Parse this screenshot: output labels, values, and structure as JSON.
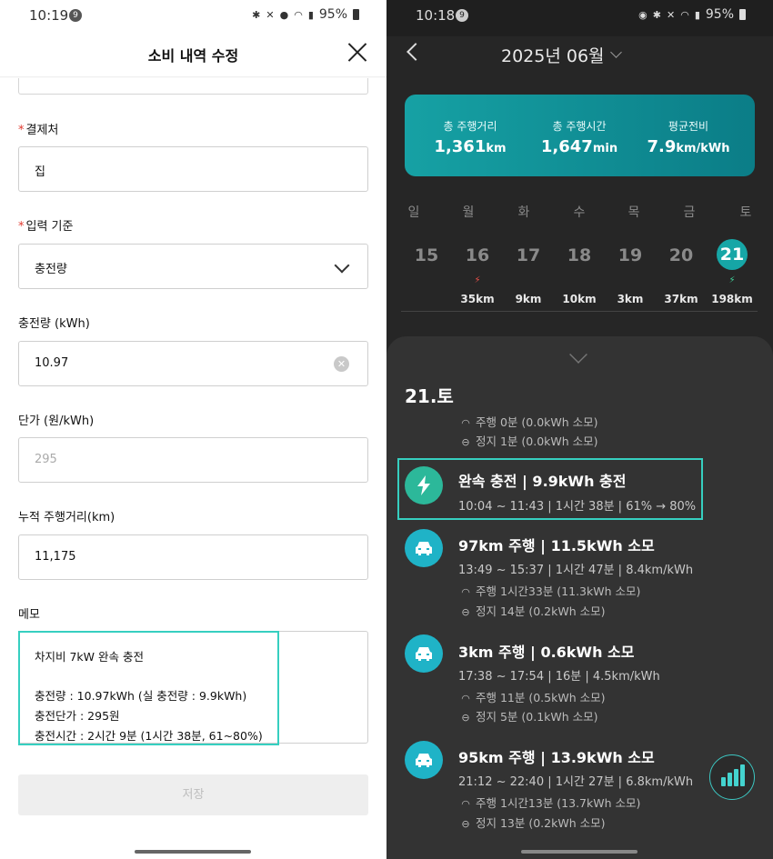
{
  "left_screen": {
    "status_bar": {
      "time": "10:19",
      "badge": "9",
      "battery": "95%"
    },
    "header": {
      "title": "소비 내역 수정"
    },
    "fields": {
      "merchant": {
        "label": "결제처",
        "required_mark": "*",
        "value": "집"
      },
      "input_basis": {
        "label": "입력 기준",
        "required_mark": "*",
        "value": "충전량"
      },
      "charge_amount": {
        "label": "충전량 (kWh)",
        "value": "10.97"
      },
      "unit_price": {
        "label": "단가 (원/kWh)",
        "placeholder": "295"
      },
      "odometer": {
        "label": "누적 주행거리(km)",
        "value": "11,175"
      }
    },
    "memo": {
      "label": "메모",
      "lines": [
        "차지비 7kW 완속 충전",
        "충전량 : 10.97kWh (실 충전량 : 9.9kWh)",
        "충전단가 : 295원",
        "충전시간 : 2시간 9분 (1시간 38분, 61~80%)"
      ]
    },
    "save_button": "저장",
    "colors": {
      "required": "#e0392f",
      "highlight": "#36cfc0"
    }
  },
  "right_screen": {
    "status_bar": {
      "time": "10:18",
      "badge": "9",
      "battery": "95%"
    },
    "month_title": "2025년 06월",
    "summary": {
      "items": [
        {
          "label": "총 주행거리",
          "value": "1,361",
          "unit": "km"
        },
        {
          "label": "총 주행시간",
          "value": "1,647",
          "unit": "min"
        },
        {
          "label": "평균전비",
          "value": "7.9",
          "unit": "km/kWh"
        }
      ]
    },
    "weekdays": [
      "일",
      "월",
      "화",
      "수",
      "목",
      "금",
      "토"
    ],
    "dates": [
      {
        "day": "15",
        "km": "",
        "bolt": ""
      },
      {
        "day": "16",
        "km": "35km",
        "bolt": "red"
      },
      {
        "day": "17",
        "km": "9km",
        "bolt": ""
      },
      {
        "day": "18",
        "km": "10km",
        "bolt": ""
      },
      {
        "day": "19",
        "km": "3km",
        "bolt": ""
      },
      {
        "day": "20",
        "km": "37km",
        "bolt": ""
      },
      {
        "day": "21",
        "km": "198km",
        "bolt": "green"
      }
    ],
    "selected_day_title": "21.토",
    "top_subrows": [
      "주행 0분 (0.0kWh 소모)",
      "정지 1분 (0.0kWh 소모)"
    ],
    "events": [
      {
        "icon": "bolt-icon",
        "title": "완속 충전 | 9.9kWh 충전",
        "detail": "10:04 ~ 11:43 | 1시간 38분 | 61% → 80%",
        "subrows": []
      },
      {
        "icon": "car-icon",
        "title": "97km 주행 | 11.5kWh 소모",
        "detail": "13:49 ~ 15:37 | 1시간 47분 | 8.4km/kWh",
        "subrows": [
          "주행 1시간33분 (11.3kWh 소모)",
          "정지 14분 (0.2kWh 소모)"
        ]
      },
      {
        "icon": "car-icon",
        "title": "3km 주행 | 0.6kWh 소모",
        "detail": "17:38 ~ 17:54 | 16분 | 4.5km/kWh",
        "subrows": [
          "주행 11분 (0.5kWh 소모)",
          "정지 5분 (0.1kWh 소모)"
        ]
      },
      {
        "icon": "car-icon",
        "title": "95km 주행 | 13.9kWh 소모",
        "detail": "21:12 ~ 22:40 | 1시간 27분 | 6.8km/kWh",
        "subrows": [
          "주행 1시간13분 (13.7kWh 소모)",
          "정지 13분 (0.2kWh 소모)"
        ]
      }
    ],
    "colors": {
      "accent": "#16a6a6",
      "card_gradient_start": "#16a1a4",
      "card_gradient_end": "#0b7d87",
      "bolt_red": "#f0524a",
      "bolt_green": "#3fd39b"
    }
  }
}
